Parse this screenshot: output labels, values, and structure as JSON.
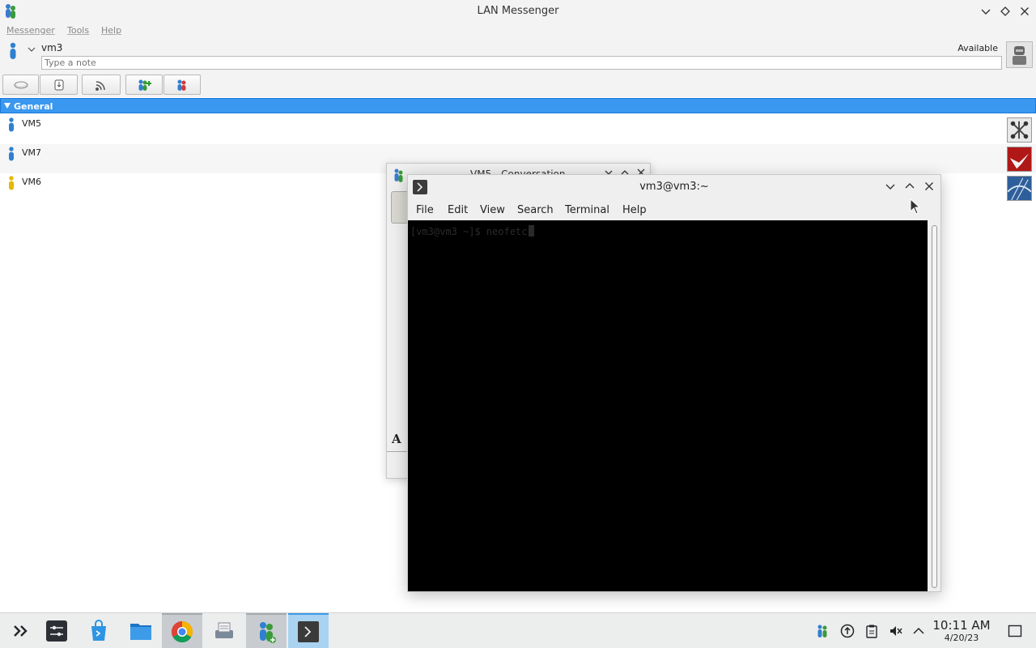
{
  "messenger": {
    "window_title": "LAN Messenger",
    "menu": [
      "Messenger",
      "Tools",
      "Help"
    ],
    "user": {
      "name": "vm3",
      "status": "Available",
      "note_placeholder": "Type a note"
    },
    "toolbar_icons": [
      "chat-icon",
      "file-transfer-icon",
      "broadcast-icon",
      "add-group-icon",
      "settings-icon"
    ],
    "group": {
      "name": "General"
    },
    "contacts": [
      {
        "name": "VM5",
        "status_color": "#2f80d0",
        "avatar": "network-avatar"
      },
      {
        "name": "VM7",
        "status_color": "#2f80d0",
        "avatar": "crane-avatar"
      },
      {
        "name": "VM6",
        "status_color": "#e6b800",
        "avatar": "bridge-avatar"
      }
    ]
  },
  "conversation": {
    "title": "VM5 - Conversation"
  },
  "terminal": {
    "window_title": "vm3@vm3:~",
    "menu": [
      "File",
      "Edit",
      "View",
      "Search",
      "Terminal",
      "Help"
    ],
    "prompt": "[vm3@vm3 ~]$ neofetc"
  },
  "taskbar": {
    "apps": [
      "application-launcher",
      "system-settings",
      "discover-store",
      "file-manager",
      "chrome",
      "scanner",
      "lan-messenger",
      "terminal"
    ],
    "clock_time": "10:11 AM",
    "clock_date": "4/20/23"
  },
  "colors": {
    "group_header": "#3a98f0",
    "terminal_bg": "#000000",
    "taskbar_focus": "#a9d3f0"
  }
}
